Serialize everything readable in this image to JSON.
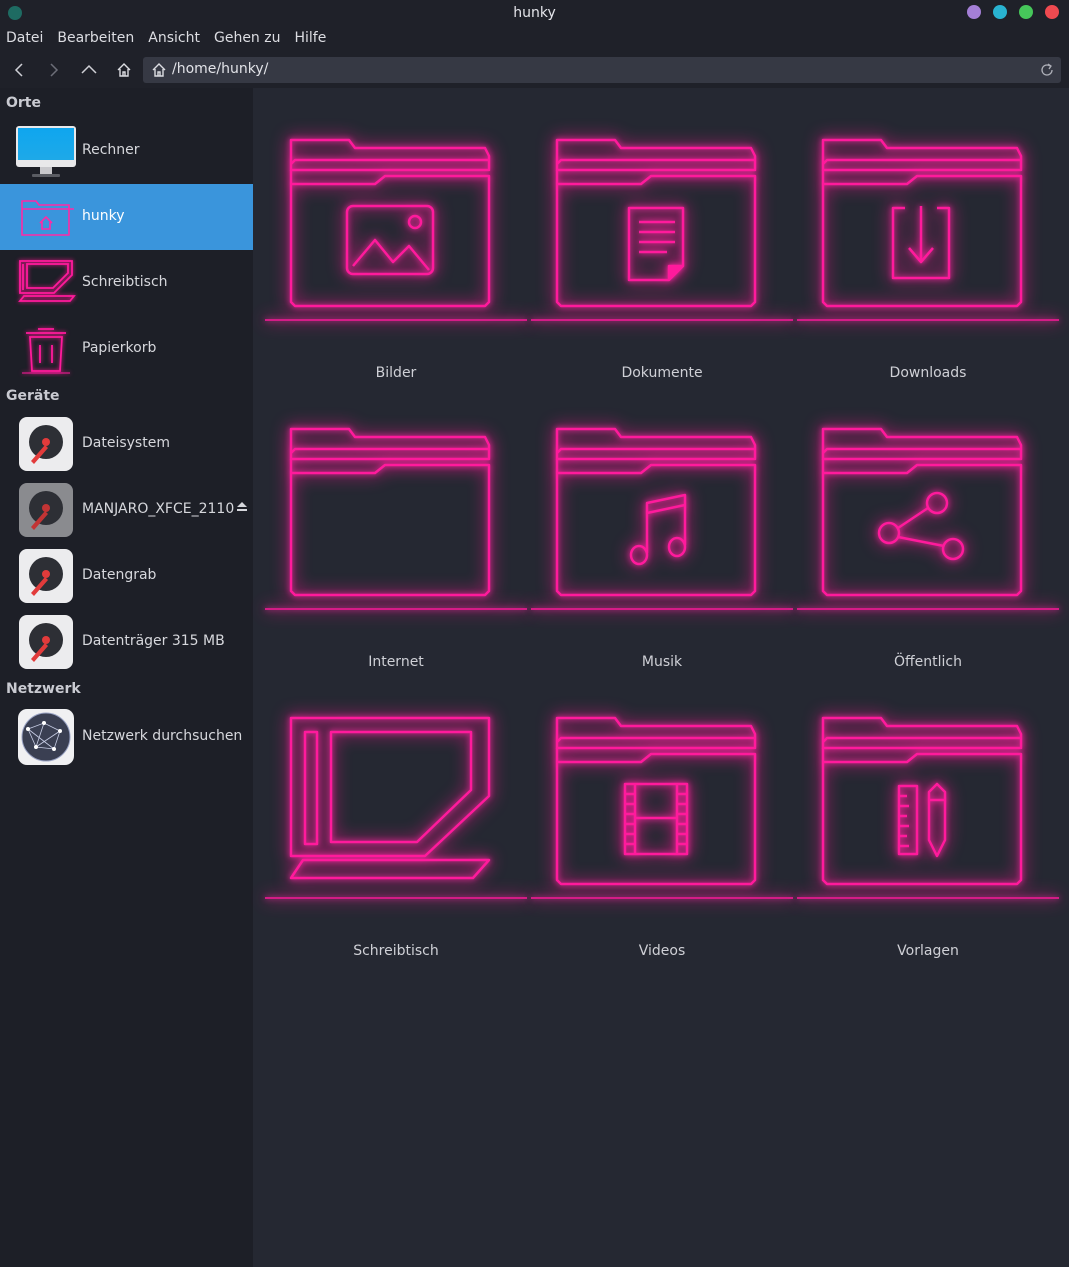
{
  "window": {
    "title": "hunky"
  },
  "menu": [
    "Datei",
    "Bearbeiten",
    "Ansicht",
    "Gehen zu",
    "Hilfe"
  ],
  "location": {
    "path": "/home/hunky/"
  },
  "sidebar": {
    "places_title": "Orte",
    "places": [
      {
        "label": "Rechner",
        "icon": "computer-icon"
      },
      {
        "label": "hunky",
        "icon": "home-folder-icon"
      },
      {
        "label": "Schreibtisch",
        "icon": "desktop-icon"
      },
      {
        "label": "Papierkorb",
        "icon": "trash-icon"
      }
    ],
    "devices_title": "Geräte",
    "devices": [
      {
        "label": "Dateisystem",
        "icon": "drive-icon"
      },
      {
        "label": "MANJARO_XFCE_2110",
        "icon": "drive-icon"
      },
      {
        "label": "Datengrab",
        "icon": "drive-icon"
      },
      {
        "label": "Datenträger 315 MB",
        "icon": "drive-icon"
      }
    ],
    "network_title": "Netzwerk",
    "network": [
      {
        "label": "Netzwerk durchsuchen",
        "icon": "network-globe-icon"
      }
    ]
  },
  "files": [
    {
      "label": "Bilder",
      "icon": "pictures-folder-icon"
    },
    {
      "label": "Dokumente",
      "icon": "documents-folder-icon"
    },
    {
      "label": "Downloads",
      "icon": "downloads-folder-icon"
    },
    {
      "label": "Internet",
      "icon": "folder-icon"
    },
    {
      "label": "Musik",
      "icon": "music-folder-icon"
    },
    {
      "label": "Öffentlich",
      "icon": "public-folder-icon"
    },
    {
      "label": "Schreibtisch",
      "icon": "desktop-icon"
    },
    {
      "label": "Videos",
      "icon": "videos-folder-icon"
    },
    {
      "label": "Vorlagen",
      "icon": "templates-folder-icon"
    }
  ],
  "colors": {
    "neon": "#ff1a9c",
    "selection": "#3a95dc",
    "window_dots": [
      "#a47fd6",
      "#29b3d1",
      "#46c75a",
      "#ef4a50"
    ]
  }
}
